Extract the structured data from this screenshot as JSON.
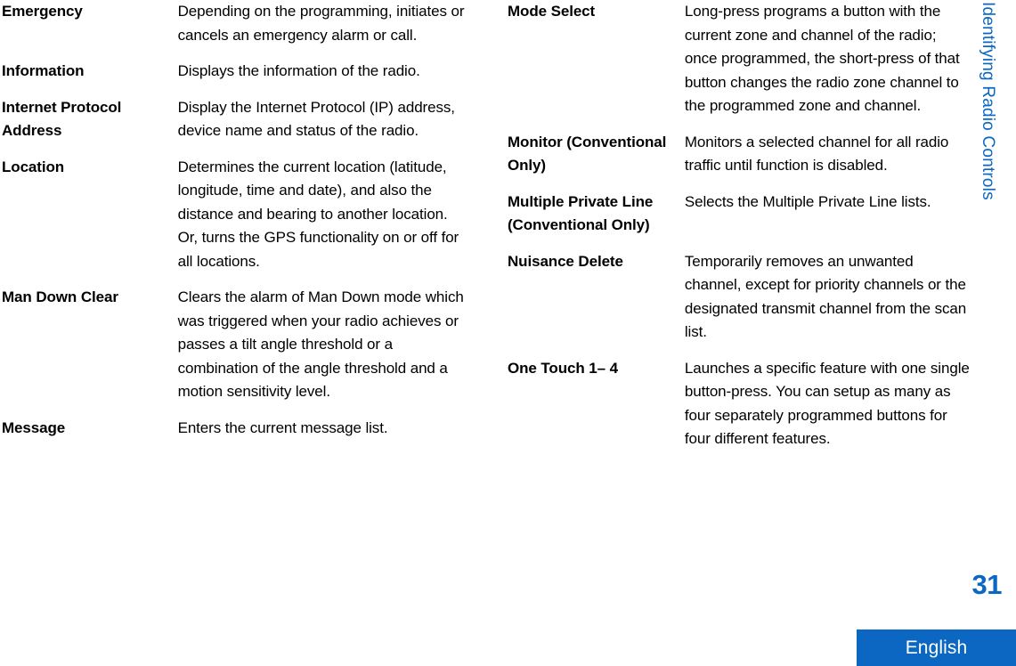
{
  "document": {
    "chapter_tab": "Identifying Radio Controls",
    "page_number": "31",
    "language": "English",
    "accent_color": "#0B67C2",
    "text_color": "#000000"
  },
  "columns": {
    "left": {
      "rows": [
        {
          "term": "Emergency",
          "description": "Depending on the programming, initiates or cancels an emergency alarm or call."
        },
        {
          "term": "Information",
          "description": "Displays the information of the radio."
        },
        {
          "term": "Internet Protocol Address",
          "description": "Display the Internet Protocol (IP) address, device name and status of the radio."
        },
        {
          "term": "Location",
          "description": "Determines the current location (latitude, longitude, time and date), and also the distance and bearing to another location. Or, turns the GPS functionality on or off for all locations."
        },
        {
          "term": "Man Down Clear",
          "description": "Clears the alarm of Man Down mode which was triggered when your radio achieves or passes a tilt angle threshold or a combination of the angle threshold and a motion sensitivity level."
        },
        {
          "term": "Message",
          "description": "Enters the current message list."
        }
      ]
    },
    "right": {
      "rows": [
        {
          "term": "Mode Select",
          "description": "Long-press programs a button with the current zone and channel of the radio; once programmed, the short-press of that button changes the radio zone channel to the programmed zone and channel."
        },
        {
          "term": "Monitor (Conventional Only)",
          "description": "Monitors a selected channel for all radio traffic until function is disabled."
        },
        {
          "term": "Multiple Private Line (Conventional Only)",
          "description": "Selects the Multiple Private Line lists."
        },
        {
          "term": "Nuisance Delete",
          "description": "Temporarily removes an unwanted channel, except for priority channels or the designated transmit channel from the scan list."
        },
        {
          "term": "One Touch 1– 4",
          "description": "Launches a specific feature with one single button-press. You can setup as many as four separately programmed buttons for four different features."
        }
      ]
    }
  }
}
